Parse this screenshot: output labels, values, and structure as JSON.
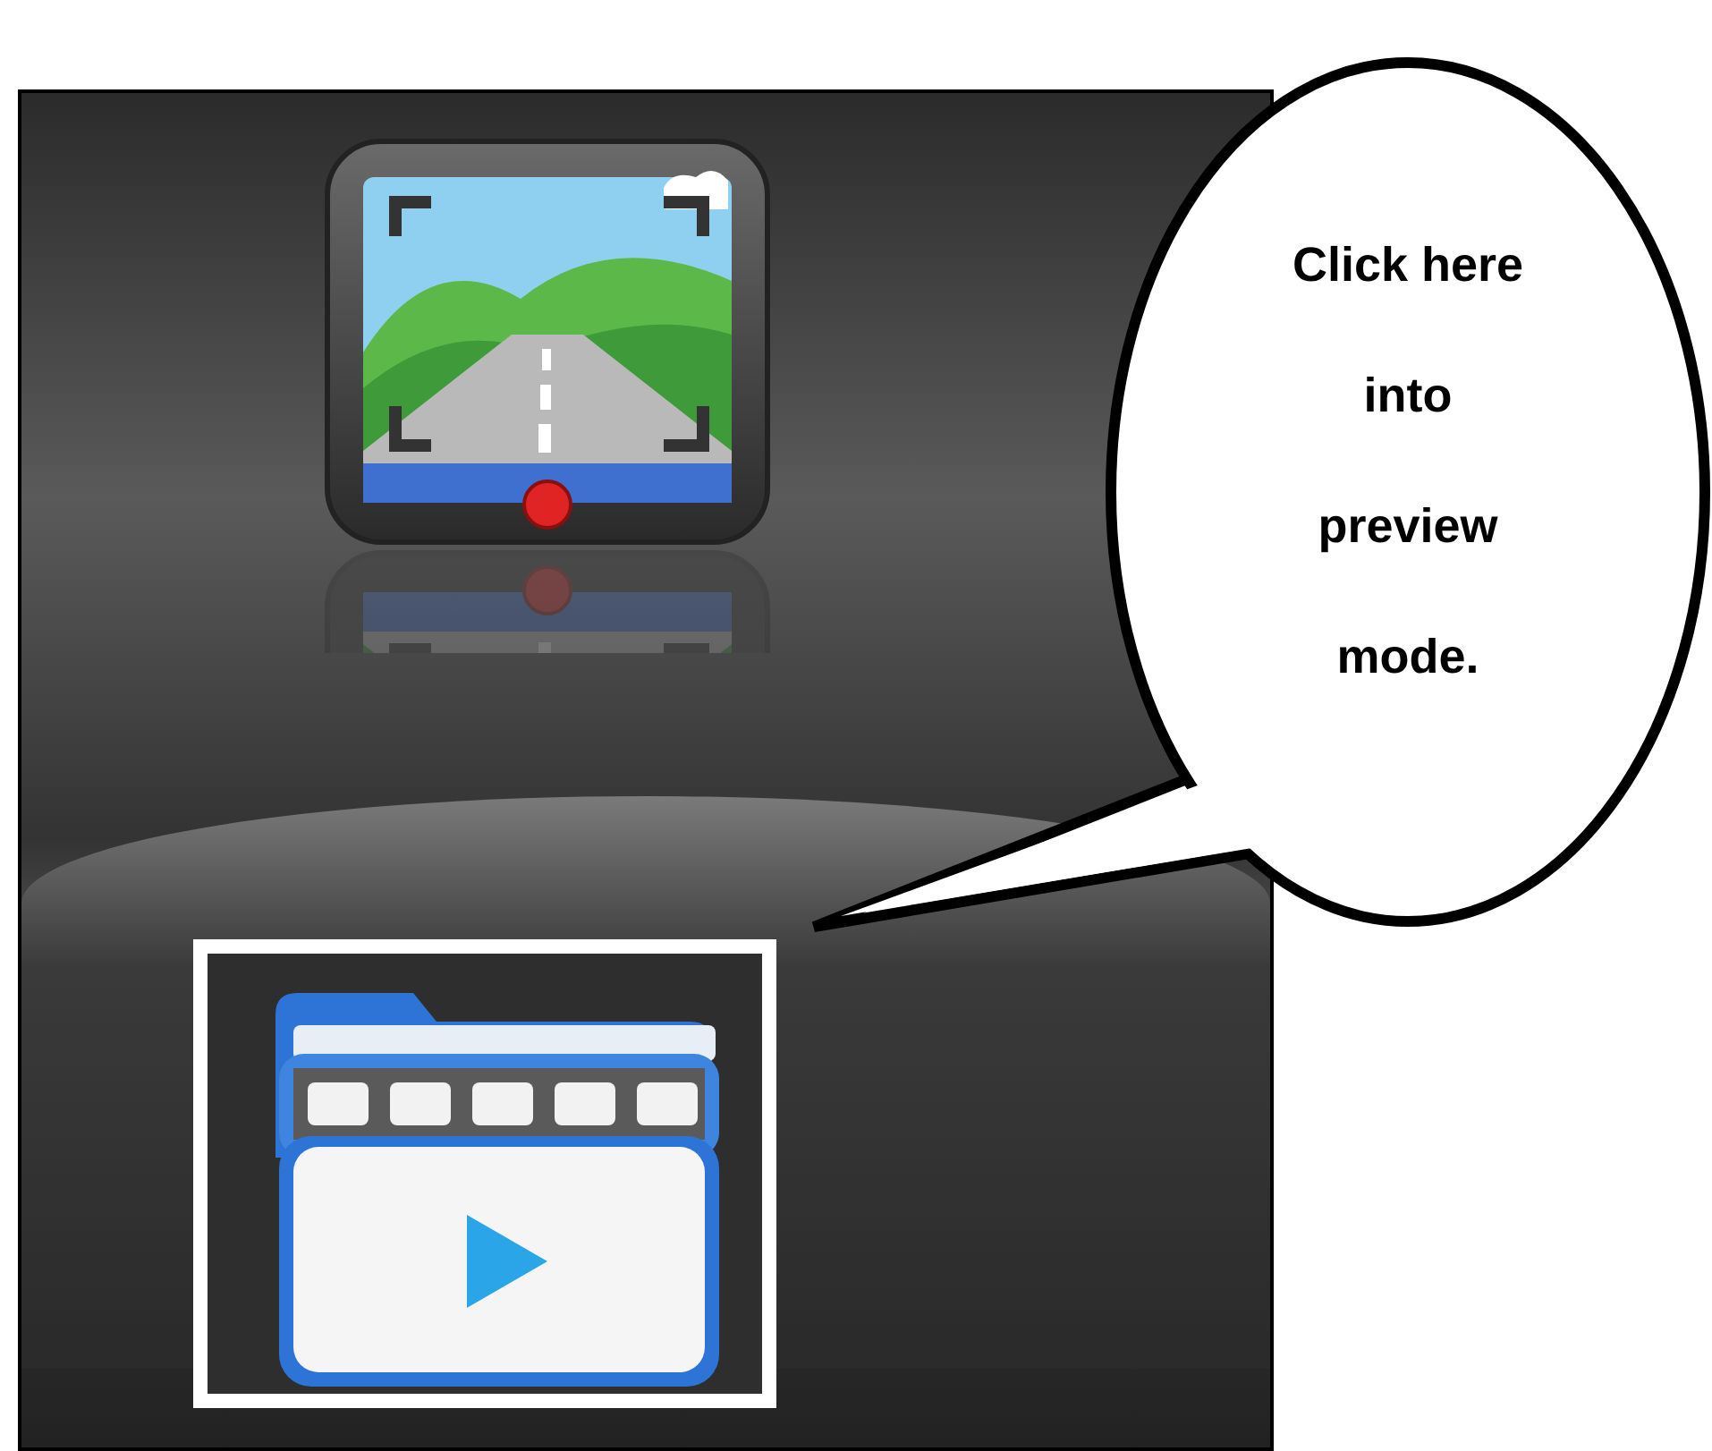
{
  "callout": {
    "text": "Click here into preview mode."
  }
}
